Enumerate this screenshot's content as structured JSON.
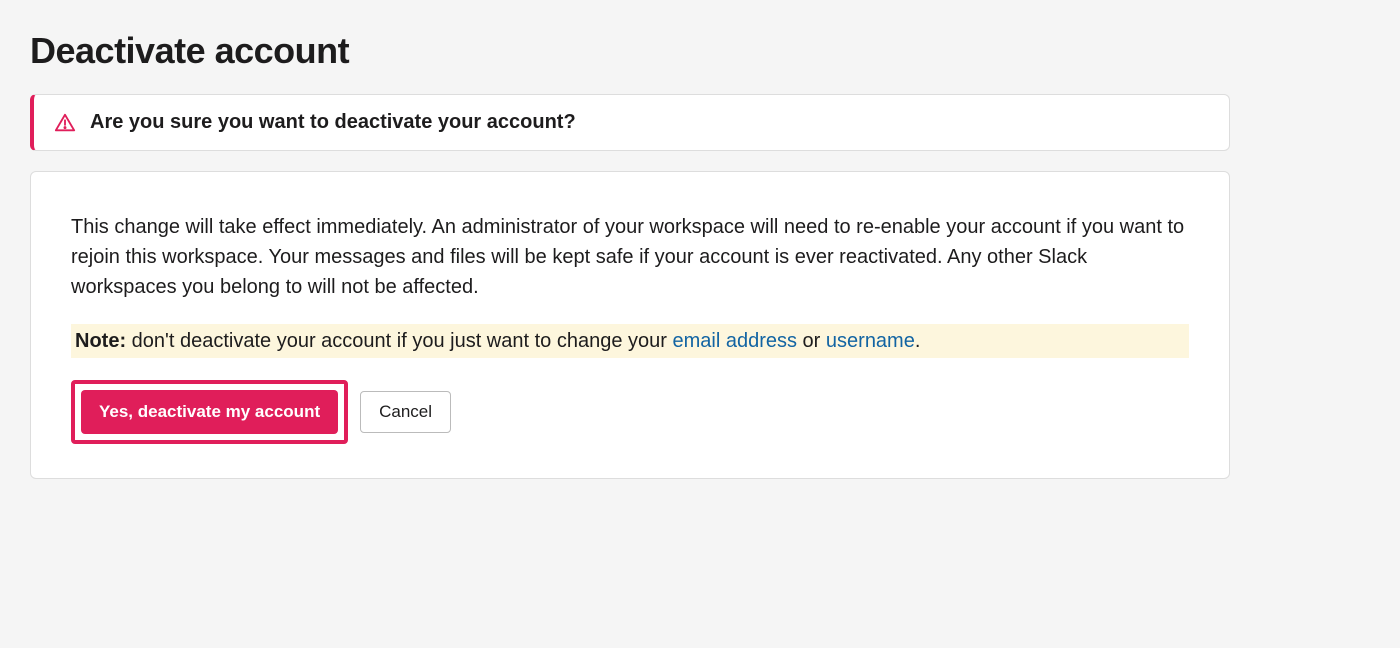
{
  "page": {
    "title": "Deactivate account"
  },
  "banner": {
    "text": "Are you sure you want to deactivate your account?"
  },
  "content": {
    "description": "This change will take effect immediately. An administrator of your workspace will need to re-enable your account if you want to rejoin this workspace. Your messages and files will be kept safe if your account is ever reactivated. Any other Slack workspaces you belong to will not be affected.",
    "note_label": "Note:",
    "note_prefix": " don't deactivate your account if you just want to change your ",
    "note_link_email": "email address",
    "note_middle": " or ",
    "note_link_username": "username",
    "note_suffix": "."
  },
  "buttons": {
    "confirm": "Yes, deactivate my account",
    "cancel": "Cancel"
  }
}
